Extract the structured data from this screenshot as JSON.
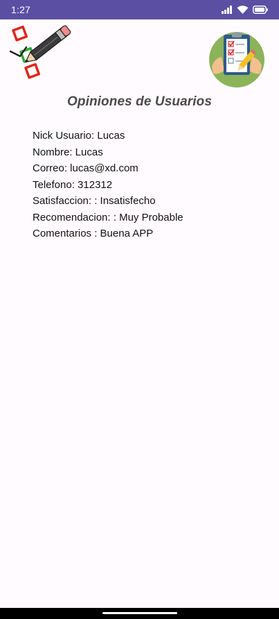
{
  "status_bar": {
    "time": "1:27",
    "icons": [
      "signal-icon",
      "wifi-icon",
      "battery-icon"
    ]
  },
  "header": {
    "left_logo": "checklist-pencil-icon",
    "right_logo": "clipboard-survey-icon",
    "title": "Opiniones de Usuarios"
  },
  "details": [
    {
      "label": "Nick Usuario: Lucas"
    },
    {
      "label": "Nombre: Lucas"
    },
    {
      "label": "Correo: lucas@xd.com"
    },
    {
      "label": "Telefono: 312312"
    },
    {
      "label": "Satisfaccion: : Insatisfecho"
    },
    {
      "label": "Recomendacion: : Muy Probable"
    },
    {
      "label": "Comentarios : Buena APP"
    }
  ],
  "colors": {
    "status_bar": "#5b4fa3",
    "background": "#fffbfe",
    "title": "#4a4a4a",
    "text": "#111111"
  }
}
